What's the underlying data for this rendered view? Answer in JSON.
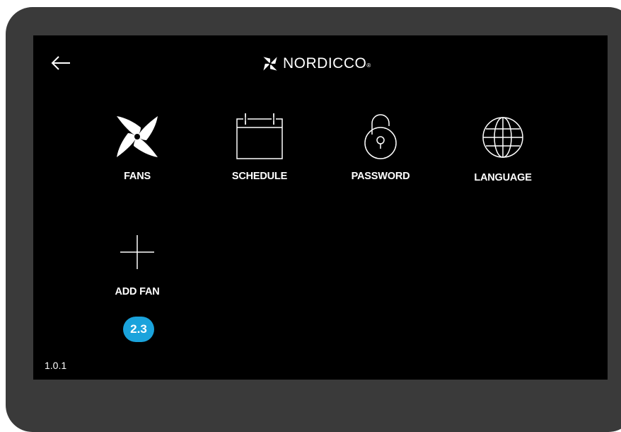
{
  "header": {
    "back_icon": "arrow-left-icon",
    "brand_name": "NORDICCO",
    "brand_mark": "®"
  },
  "tiles": [
    {
      "label": "FANS",
      "icon": "fan-icon"
    },
    {
      "label": "SCHEDULE",
      "icon": "calendar-icon"
    },
    {
      "label": "PASSWORD",
      "icon": "padlock-icon"
    },
    {
      "label": "LANGUAGE",
      "icon": "globe-icon"
    },
    {
      "label": "ADD FAN",
      "icon": "plus-icon"
    }
  ],
  "badge": {
    "text": "2.3",
    "color": "#1aa3dc"
  },
  "footer": {
    "version": "1.0.1"
  },
  "colors": {
    "screen": "#000000",
    "bezel": "#3a3a3a",
    "text": "#ffffff"
  }
}
